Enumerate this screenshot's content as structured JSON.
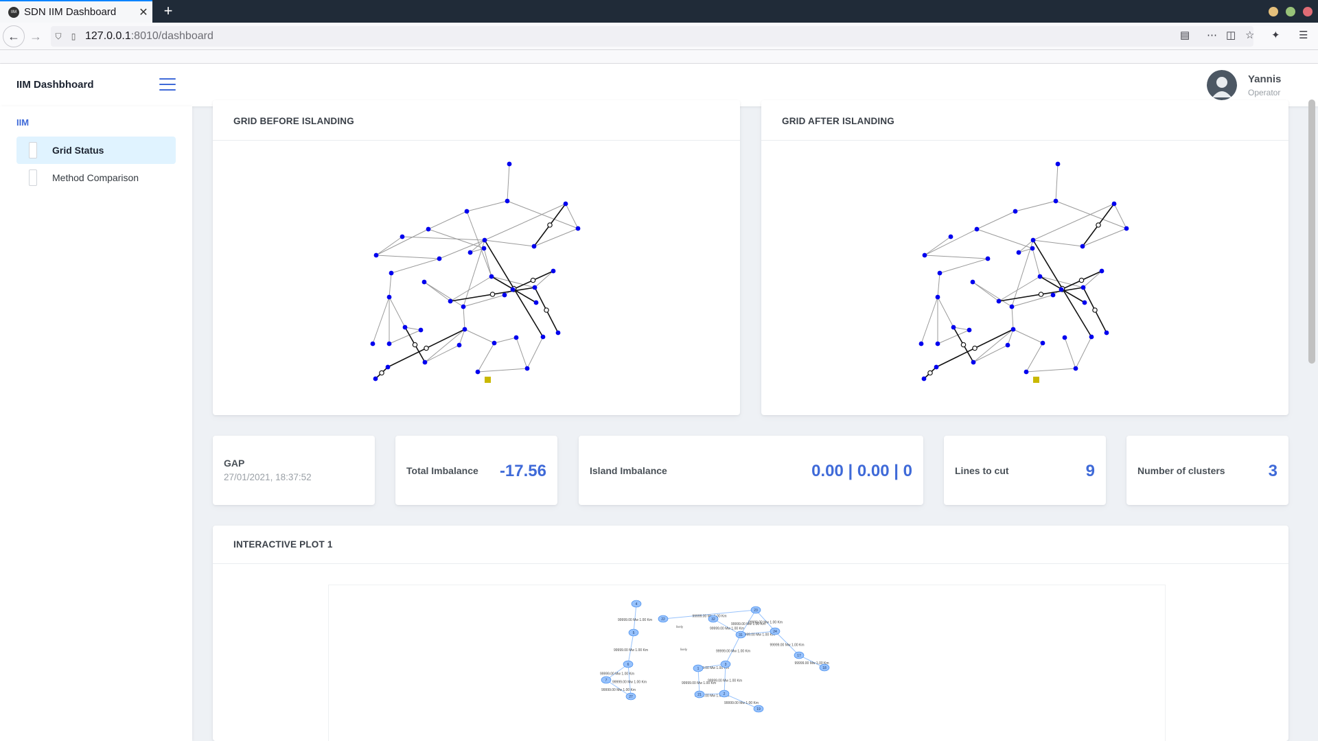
{
  "browser": {
    "tab_title": "SDN IIM Dashboard",
    "favicon_text": "IIM",
    "url_host": "127.0.0.1",
    "url_path": ":8010/dashboard"
  },
  "header": {
    "brand": "IIM Dashbhoard",
    "user_name": "Yannis",
    "user_role": "Operator"
  },
  "sidebar": {
    "heading": "IIM",
    "items": [
      {
        "label": "Grid Status",
        "active": true
      },
      {
        "label": "Method Comparison",
        "active": false
      }
    ]
  },
  "cards": {
    "before": {
      "title": "GRID BEFORE ISLANDING"
    },
    "after": {
      "title": "GRID AFTER ISLANDING"
    },
    "plot": {
      "title": "INTERACTIVE PLOT 1"
    }
  },
  "stats": {
    "gap_label": "GAP",
    "gap_time": "27/01/2021, 18:37:52",
    "total_imbalance_label": "Total Imbalance",
    "total_imbalance_value": "-17.56",
    "island_imbalance_label": "Island Imbalance",
    "island_imbalance_value": "0.00 | 0.00 | 0",
    "lines_to_cut_label": "Lines to cut",
    "lines_to_cut_value": "9",
    "clusters_label": "Number of clusters",
    "clusters_value": "3"
  },
  "colors": {
    "accent": "#3f6ad8",
    "node": "#0000ee",
    "slack_bus": "#c9b800",
    "plot_node": "#97c2fc"
  },
  "plot": {
    "edge_label": "99999.00 Mw 1.00 Km",
    "node_ids": [
      "4",
      "5",
      "6",
      "7",
      "27",
      "22",
      "23",
      "32",
      "24",
      "17",
      "18",
      "31",
      "1",
      "3",
      "2",
      "21",
      "19"
    ],
    "small_label": "lively"
  }
}
